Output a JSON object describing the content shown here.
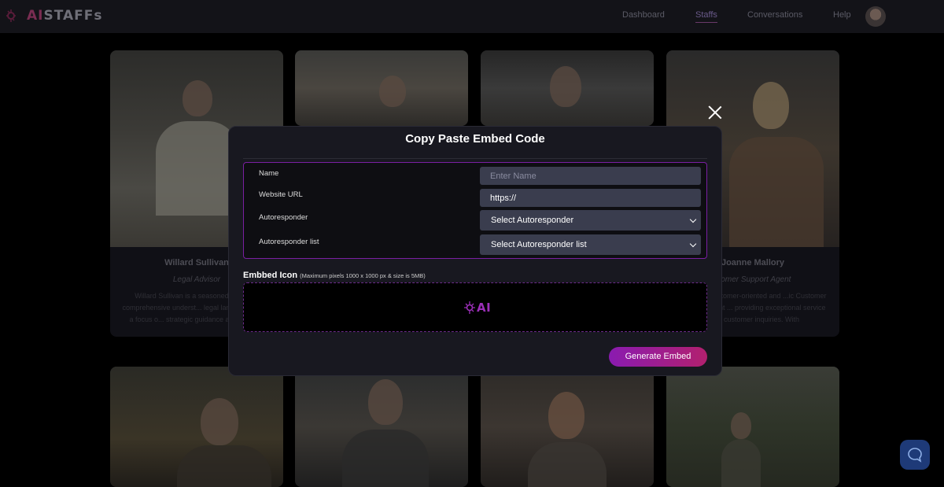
{
  "brand": {
    "logo_text": "STAFFs",
    "logo_prefix": "AI",
    "logo_icon": "ai-brain-logo-icon"
  },
  "nav": {
    "items": [
      {
        "label": "Dashboard"
      },
      {
        "label": "Staffs",
        "active": true
      },
      {
        "label": "Conversations"
      },
      {
        "label": "Help"
      }
    ],
    "avatar_icon": "user-avatar"
  },
  "cards": [
    {
      "name": "Willard Sullivan",
      "role": "Legal Advisor",
      "desc": "Willard Sullivan is a seasoned l... with a comprehensive underst... legal landscape. With a focus o... strategic guidance and minim..."
    },
    {
      "name": "",
      "role": "",
      "desc": ""
    },
    {
      "name": "",
      "role": "",
      "desc": ""
    },
    {
      "name": "Joanne Mallory",
      "role": "stomer Support Agent",
      "desc": "...ory is a customer-oriented and ...ic Customer Support Agent ... providing exceptional service ...ing customer inquiries. With"
    }
  ],
  "modal": {
    "title": "Copy Paste Embed Code",
    "close_icon": "close-icon",
    "fields": {
      "name_label": "Name",
      "name_placeholder": "Enter Name",
      "url_label": "Website URL",
      "url_value": "https://",
      "autoresponder_label": "Autoresponder",
      "autoresponder_value": "Select Autoresponder",
      "autoresponder_list_label": "Autoresponder list",
      "autoresponder_list_value": "Select Autoresponder list"
    },
    "embed_icon_label": "Embbed Icon",
    "embed_icon_note": "(Maximum pixels 1000 x 1000 px & size is 5MB)",
    "drop_logo_text": "AI",
    "generate_button": "Generate Embed"
  },
  "colors": {
    "accent_purple": "#8a1bb0",
    "accent_pink": "#b2206e",
    "field_bg": "#3a3d4e",
    "modal_bg": "#181820"
  },
  "chat_widget_icon": "chat-bubble-icon"
}
